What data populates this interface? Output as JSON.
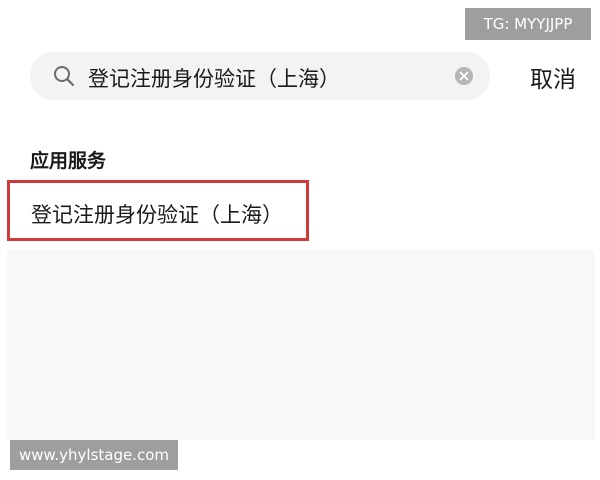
{
  "search": {
    "query": "登记注册身份验证（上海）",
    "search_icon": "search-icon",
    "clear_icon": "clear-icon"
  },
  "cancel_label": "取消",
  "section": {
    "title": "应用服务"
  },
  "results": [
    {
      "label": "登记注册身份验证（上海）"
    }
  ],
  "watermarks": {
    "tag": "TG: MYYJJPP",
    "website": "www.yhylstage.com"
  },
  "colors": {
    "highlight_border": "#d23a3a",
    "search_background": "#f2f3f5",
    "text": "#1a1a1a"
  }
}
